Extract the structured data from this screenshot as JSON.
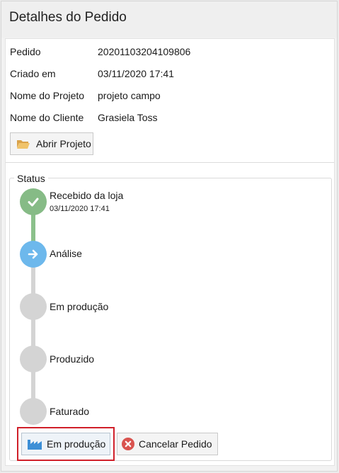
{
  "header": {
    "title": "Detalhes do Pedido"
  },
  "order": {
    "rows": [
      {
        "label": "Pedido",
        "value": "20201103204109806"
      },
      {
        "label": "Criado em",
        "value": "03/11/2020 17:41"
      },
      {
        "label": "Nome do Projeto",
        "value": "projeto campo"
      },
      {
        "label": "Nome do Cliente",
        "value": "Grasiela Toss"
      }
    ]
  },
  "actions": {
    "open_project_label": "Abrir Projeto"
  },
  "status": {
    "legend": "Status",
    "steps": [
      {
        "label": "Recebido da loja",
        "date": "03/11/2020 17:41",
        "state": "done",
        "icon": "check-icon"
      },
      {
        "label": "Análise",
        "state": "active",
        "icon": "arrow-right-icon"
      },
      {
        "label": "Em produção",
        "state": "pending"
      },
      {
        "label": "Produzido",
        "state": "pending"
      },
      {
        "label": "Faturado",
        "state": "pending"
      }
    ]
  },
  "footer": {
    "production_label": "Em produção",
    "cancel_label": "Cancelar Pedido"
  },
  "colors": {
    "done": "#86bb86",
    "active": "#6db8ec",
    "pending": "#d4d4d4",
    "highlight": "#d0202a",
    "cancel_icon": "#d9534f",
    "factory_icon": "#3d8fd6"
  }
}
